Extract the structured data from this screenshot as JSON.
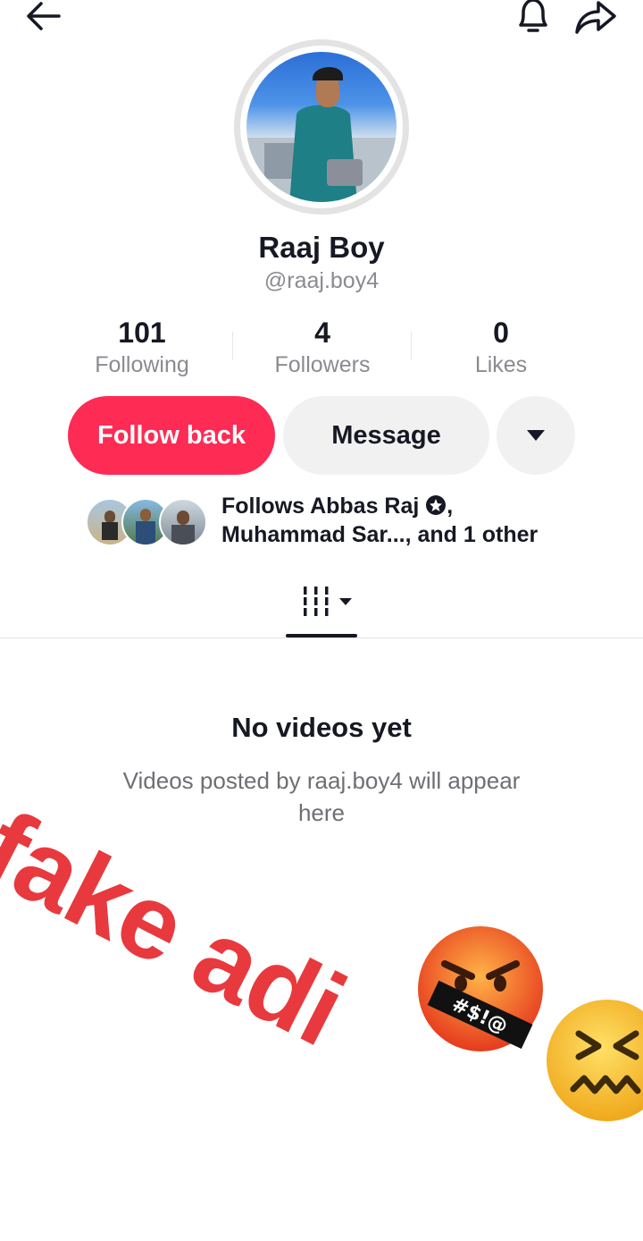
{
  "header": {
    "back_icon": "arrow-left-icon",
    "bell_icon": "bell-icon",
    "share_icon": "share-arrow-icon"
  },
  "profile": {
    "name": "Raaj Boy",
    "handle": "@raaj.boy4"
  },
  "stats": [
    {
      "value": "101",
      "label": "Following"
    },
    {
      "value": "4",
      "label": "Followers"
    },
    {
      "value": "0",
      "label": "Likes"
    }
  ],
  "actions": {
    "follow_back": "Follow back",
    "message": "Message",
    "more_icon": "caret-down-icon"
  },
  "mutuals": {
    "line1": "Follows Abbas Raj",
    "line1_end": ",",
    "line2": "Muhammad Sar..., and 1 other"
  },
  "tabs": {
    "videos_icon": "video-grid-icon",
    "sort_icon": "caret-down-icon"
  },
  "empty_state": {
    "title": "No videos yet",
    "description": "Videos posted by raaj.boy4 will appear here"
  },
  "overlay": {
    "text": "fake adi"
  },
  "colors": {
    "primary": "#fe2c55",
    "secondary_btn": "#f1f1f2",
    "overlay": "#e8393f",
    "muted_text": "#8a8b91"
  }
}
